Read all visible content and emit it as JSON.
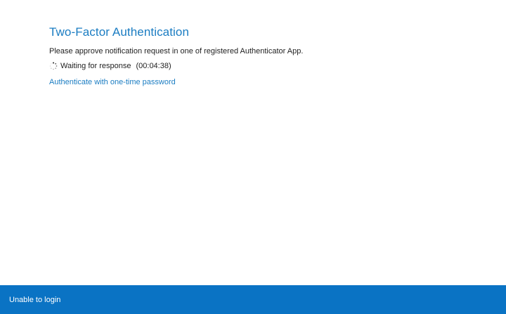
{
  "main": {
    "title": "Two-Factor Authentication",
    "instruction": "Please approve notification request in one of registered Authenticator App.",
    "status": {
      "icon": "loading-spinner-icon",
      "text": "Waiting for response",
      "timer": "(00:04:38)"
    },
    "otp_link": "Authenticate with one-time password"
  },
  "footer": {
    "link": "Unable to login",
    "background": "#0a73c4"
  },
  "colors": {
    "accent": "#1a7cc2",
    "text": "#222222"
  }
}
